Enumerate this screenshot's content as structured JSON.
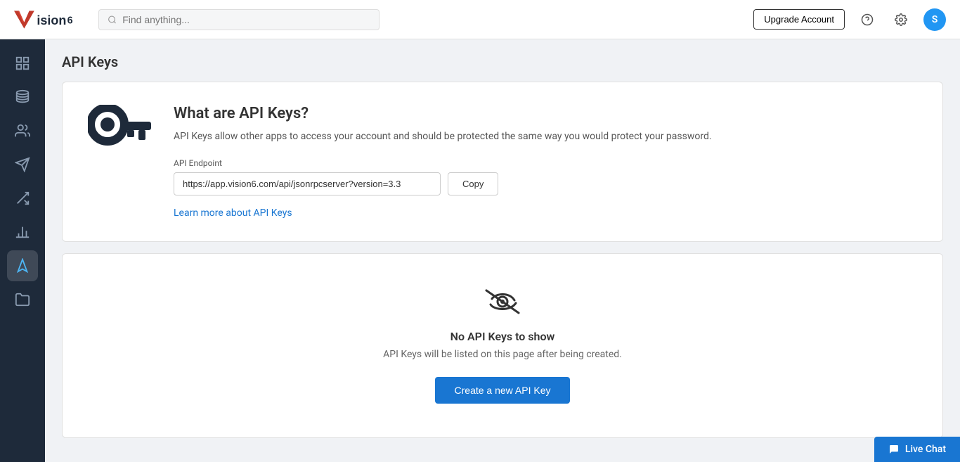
{
  "app": {
    "logo_text": "vision6"
  },
  "topnav": {
    "search_placeholder": "Find anything...",
    "upgrade_label": "Upgrade Account",
    "help_icon": "question-mark-icon",
    "settings_icon": "gear-icon",
    "avatar_letter": "S"
  },
  "sidebar": {
    "items": [
      {
        "id": "dashboard",
        "icon": "grid-icon"
      },
      {
        "id": "contacts",
        "icon": "contacts-icon"
      },
      {
        "id": "users",
        "icon": "users-icon"
      },
      {
        "id": "campaigns",
        "icon": "send-icon"
      },
      {
        "id": "automations",
        "icon": "automations-icon"
      },
      {
        "id": "reports",
        "icon": "reports-icon"
      },
      {
        "id": "api-keys",
        "icon": "api-keys-icon",
        "active": true
      },
      {
        "id": "files",
        "icon": "files-icon"
      }
    ]
  },
  "page": {
    "title": "API Keys",
    "info_card": {
      "title": "What are API Keys?",
      "description": "API Keys allow other apps to access your account and should be protected the same way you would protect your password.",
      "endpoint_label": "API Endpoint",
      "endpoint_value": "https://app.vision6.com/api/jsonrpcserver?version=3.3",
      "copy_button": "Copy",
      "learn_link": "Learn more about API Keys"
    },
    "empty_state": {
      "title": "No API Keys to show",
      "description": "API Keys will be listed on this page after being created.",
      "create_button": "Create a new API Key"
    }
  },
  "live_chat": {
    "label": "Live Chat"
  }
}
